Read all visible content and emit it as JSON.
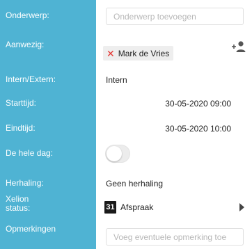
{
  "fields": {
    "subject": {
      "label": "Onderwerp:",
      "value": "",
      "placeholder": "Onderwerp toevoegen"
    },
    "attendees": {
      "label": "Aanwezig:",
      "chips": [
        "Mark de Vries"
      ]
    },
    "intern_extern": {
      "label": "Intern/Extern:",
      "value": "Intern"
    },
    "start": {
      "label": "Starttijd:",
      "value": "30-05-2020 09:00"
    },
    "end": {
      "label": "Eindtijd:",
      "value": "30-05-2020 10:00"
    },
    "all_day": {
      "label": "De hele dag:",
      "checked": false
    },
    "repeat": {
      "label": "Herhaling:",
      "value": "Geen herhaling"
    },
    "xelion_status": {
      "label": "Xelion status:",
      "icon_text": "31",
      "value": "Afspraak"
    },
    "remarks": {
      "label": "Opmerkingen",
      "value": "",
      "placeholder": "Voeg eventuele opmerking toe"
    }
  },
  "colors": {
    "label_column": "#4fb3d3",
    "remove_chip": "#e53935"
  },
  "icons": {
    "remove": "close-icon",
    "add_attendee": "add-person-icon",
    "calendar": "calendar-icon",
    "expand": "chevron-right-icon"
  }
}
